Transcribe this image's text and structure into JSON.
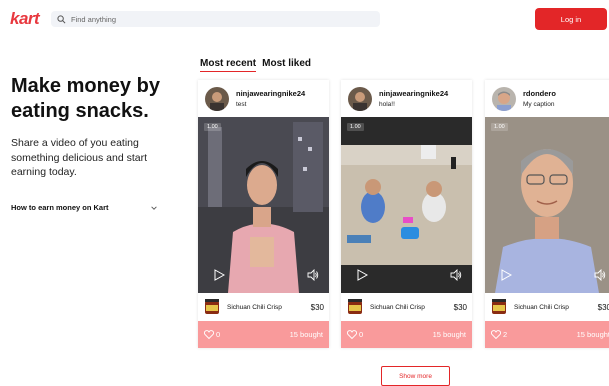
{
  "header": {
    "logo": "kart",
    "search_placeholder": "Find anything",
    "login_label": "Log in"
  },
  "hero": {
    "title": "Make money by eating snacks.",
    "subtitle": "Share a video of you eating something delicious and start earning today.",
    "earn_link": "How to earn money on Kart"
  },
  "tabs": [
    {
      "label": "Most recent",
      "active": true
    },
    {
      "label": "Most liked",
      "active": false
    }
  ],
  "cards": [
    {
      "username": "ninjawearingnike24",
      "caption": "test",
      "duration": "1.00",
      "product": "Sichuan Chili Crisp",
      "price": "$30",
      "likes": "0",
      "bought": "15 bought"
    },
    {
      "username": "ninjawearingnike24",
      "caption": "hola!!",
      "duration": "1.00",
      "product": "Sichuan Chili Crisp",
      "price": "$30",
      "likes": "0",
      "bought": "15 bought"
    },
    {
      "username": "rdondero",
      "caption": "My caption",
      "duration": "1.00",
      "product": "Sichuan Chili Crisp",
      "price": "$30",
      "likes": "2",
      "bought": "15 bought"
    }
  ],
  "show_more_label": "Show more",
  "colors": {
    "brand": "#e8383f",
    "button": "#e32628",
    "stats_bar": "#f99a9b"
  }
}
